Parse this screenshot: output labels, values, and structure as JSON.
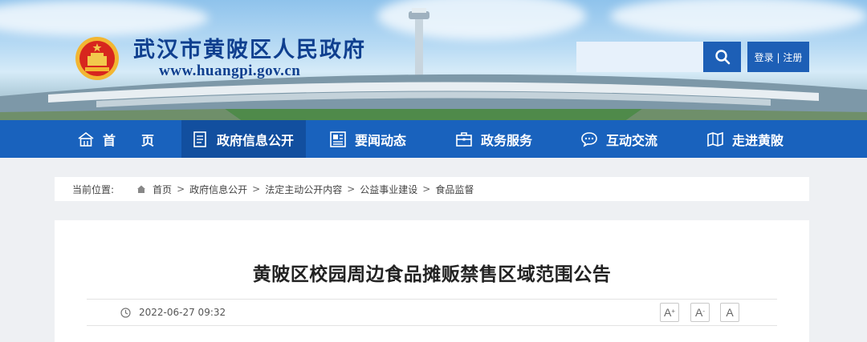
{
  "header": {
    "site_name": "武汉市黄陂区人民政府",
    "site_url": "www.huangpi.gov.cn",
    "search_placeholder": "",
    "login_label": "登录 | 注册"
  },
  "nav": {
    "items": [
      {
        "label": "首　　页",
        "icon": "home-icon"
      },
      {
        "label": "政府信息公开",
        "icon": "document-icon",
        "active": true
      },
      {
        "label": "要闻动态",
        "icon": "news-icon"
      },
      {
        "label": "政务服务",
        "icon": "briefcase-icon"
      },
      {
        "label": "互动交流",
        "icon": "chat-icon"
      },
      {
        "label": "走进黄陂",
        "icon": "map-icon"
      }
    ]
  },
  "breadcrumb": {
    "label": "当前位置:",
    "items": [
      "首页",
      "政府信息公开",
      "法定主动公开内容",
      "公益事业建设",
      "食品监督"
    ],
    "separator": ">"
  },
  "article": {
    "title": "黄陂区校园周边食品摊贩禁售区域范围公告",
    "date": "2022-06-27 09:32",
    "font_buttons": [
      "A",
      "A",
      "A"
    ]
  },
  "colors": {
    "nav_bg": "#1962bd",
    "nav_active": "#124f9f",
    "brand_text": "#0f3f8f",
    "button_bg": "#1d5fb6"
  }
}
